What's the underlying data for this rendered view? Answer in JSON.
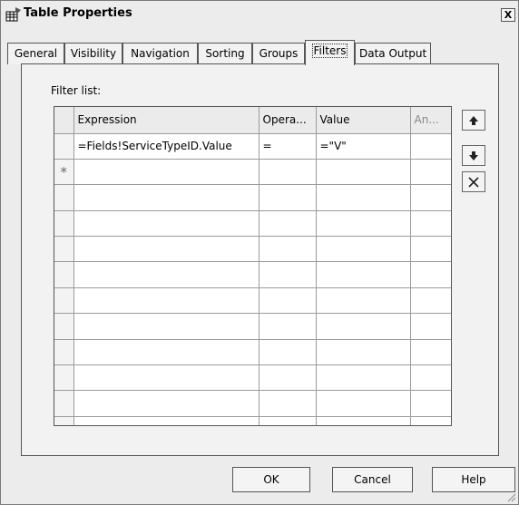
{
  "window": {
    "title": "Table Properties",
    "close_label": "X"
  },
  "tabs": [
    {
      "label": "General"
    },
    {
      "label": "Visibility"
    },
    {
      "label": "Navigation"
    },
    {
      "label": "Sorting"
    },
    {
      "label": "Groups"
    },
    {
      "label": "Filters",
      "active": true
    },
    {
      "label": "Data Output"
    }
  ],
  "filters": {
    "list_label": "Filter list:",
    "columns": [
      "Expression",
      "Opera...",
      "Value",
      "An..."
    ],
    "rows": [
      {
        "marker": "",
        "expression": "=Fields!ServiceTypeID.Value",
        "operator": "=",
        "value": "=\"V\"",
        "and_or": ""
      },
      {
        "marker": "*",
        "expression": "",
        "operator": "",
        "value": "",
        "and_or": ""
      }
    ]
  },
  "buttons": {
    "ok": "OK",
    "cancel": "Cancel",
    "help": "Help"
  },
  "icons": {
    "move_up": "arrow-up-icon",
    "move_down": "arrow-down-icon",
    "delete": "delete-x-icon"
  }
}
